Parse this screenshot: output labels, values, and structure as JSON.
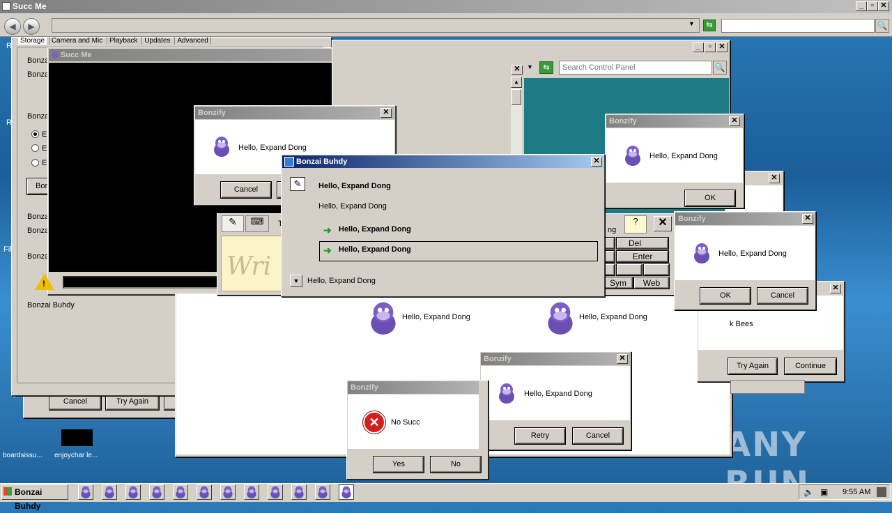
{
  "browser": {
    "title": "Succ Me",
    "search_placeholder": ""
  },
  "settings_window": {
    "tabs": [
      "Storage",
      "Camera and Mic",
      "Playback",
      "Updates",
      "Advanced"
    ],
    "rows": [
      "Bonza",
      "Bonza",
      "Bonza",
      "E",
      "E",
      "E",
      "Bor",
      "Bonza",
      "Bonza",
      "Bonza"
    ],
    "status_label": "Bonzai Buhdy"
  },
  "video_window": {
    "title": "Succ Me"
  },
  "control_panel": {
    "search_placeholder": "Search Control Panel"
  },
  "back_dialog": {
    "buttons": [
      "Cancel",
      "Try Again",
      "Continue"
    ]
  },
  "dialogs": {
    "d1": {
      "title": "Bonzify",
      "message": "Hello, Expand Dong",
      "buttons": [
        "Cancel"
      ]
    },
    "d2": {
      "title": "Bonzify",
      "message": "Hello, Expand Dong",
      "buttons": [
        "OK"
      ]
    },
    "d3": {
      "title": "Bonzify",
      "message": "Hello, Expand Dong",
      "buttons": [
        "OK",
        "Cancel"
      ]
    },
    "d4": {
      "title": "Bonzify",
      "message": "Hello, Expand Dong",
      "buttons": [
        "Retry",
        "Cancel"
      ]
    },
    "d5": {
      "title": "Bonzify",
      "message": "No Succ",
      "buttons": [
        "Yes",
        "No"
      ]
    },
    "d6": {
      "partial": "k Bees",
      "buttons": [
        "Try Again",
        "Continue"
      ]
    }
  },
  "task_dialog": {
    "title": "Bonzai Buhdy",
    "heading": "Hello, Expand Dong",
    "body": "Hello, Expand Dong",
    "link1": "Hello, Expand Dong",
    "link2": "Hello, Expand Dong",
    "details": "Hello, Expand Dong"
  },
  "keyboard": {
    "keys": [
      "Del",
      "Enter",
      "Sym",
      "Web"
    ],
    "tab_partial": "ng",
    "tab_text": "T",
    "write_hint": "Wri"
  },
  "big_window": {
    "msg1": "Hello, Expand Dong",
    "msg2": "Hello, Expand Dong"
  },
  "desktop": {
    "icons": [
      "boardsissu...",
      "enjoychar le..."
    ],
    "left_letters": [
      "R",
      "R",
      "File",
      "Chi"
    ]
  },
  "taskbar": {
    "start": "Bonzai Buhdy",
    "clock": "9:55 AM",
    "count_icons": 12
  },
  "watermark": "ANY RUN"
}
